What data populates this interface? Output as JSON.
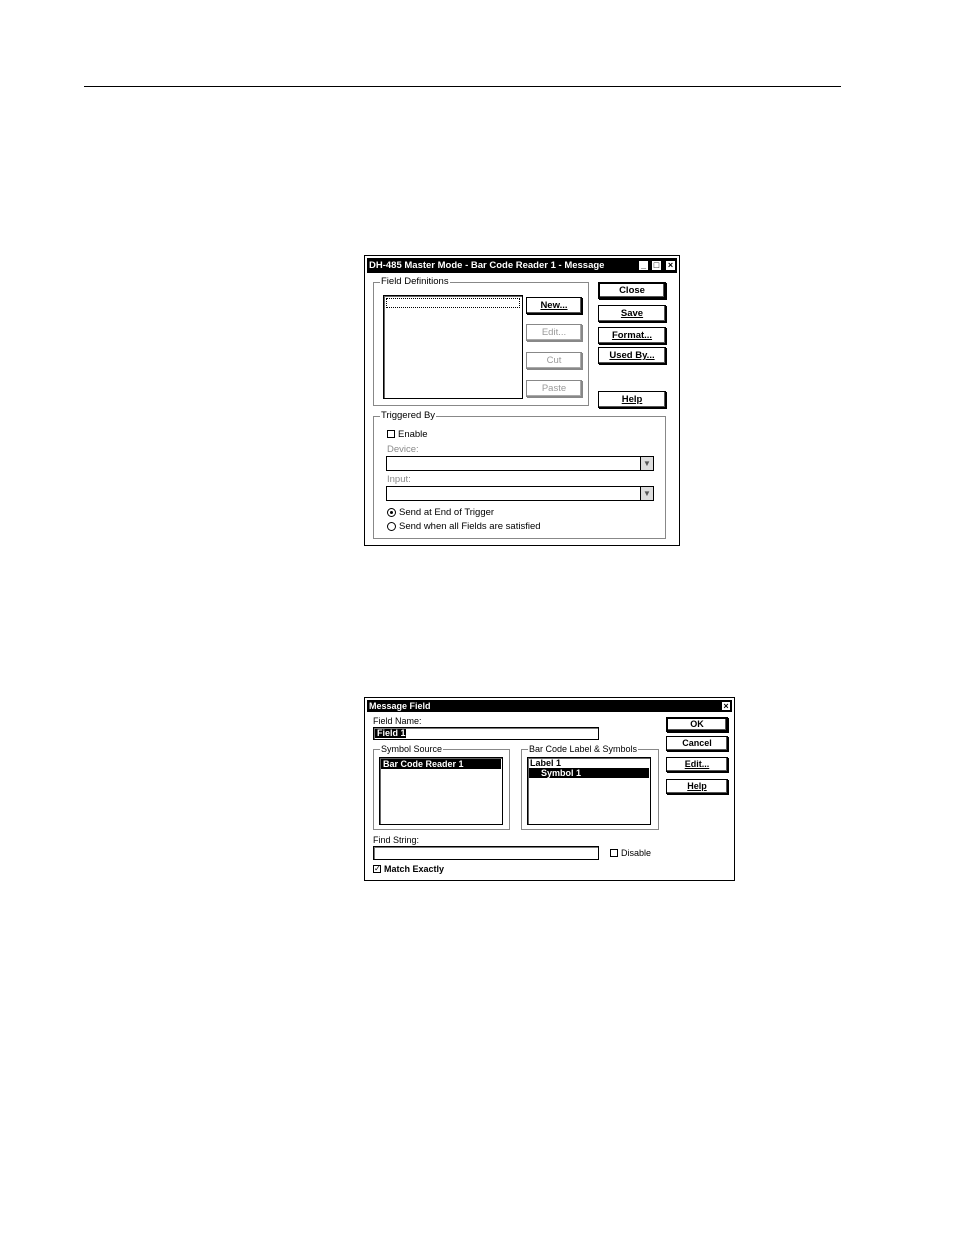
{
  "dialog1": {
    "title": "DH-485 Master Mode - Bar Code Reader 1 - Message",
    "field_definitions": "Field Definitions",
    "buttons": {
      "new": "New...",
      "edit": "Edit...",
      "cut": "Cut",
      "paste": "Paste",
      "close": "Close",
      "save": "Save",
      "format": "Format...",
      "used_by": "Used By...",
      "help": "Help"
    },
    "triggered_by": "Triggered By",
    "enable": "Enable",
    "device_label": "Device:",
    "input_label": "Input:",
    "radio_end": "Send at End of Trigger",
    "radio_all": "Send when all Fields are satisfied",
    "window_icons": {
      "minimize": "_",
      "maximize": "□",
      "close": "×"
    }
  },
  "dialog2": {
    "title": "Message Field",
    "field_name_label": "Field Name:",
    "field_name_value": "Field 1",
    "symbol_source": "Symbol Source",
    "symbol_source_items": [
      "Bar Code Reader 1"
    ],
    "barcode_group": "Bar Code Label & Symbols",
    "barcode_items": [
      "Label 1",
      "Symbol 1"
    ],
    "buttons": {
      "ok": "OK",
      "cancel": "Cancel",
      "edit": "Edit...",
      "help": "Help"
    },
    "find_string_label": "Find String:",
    "disable": "Disable",
    "match_exactly": "Match Exactly",
    "close_icon": "×"
  }
}
